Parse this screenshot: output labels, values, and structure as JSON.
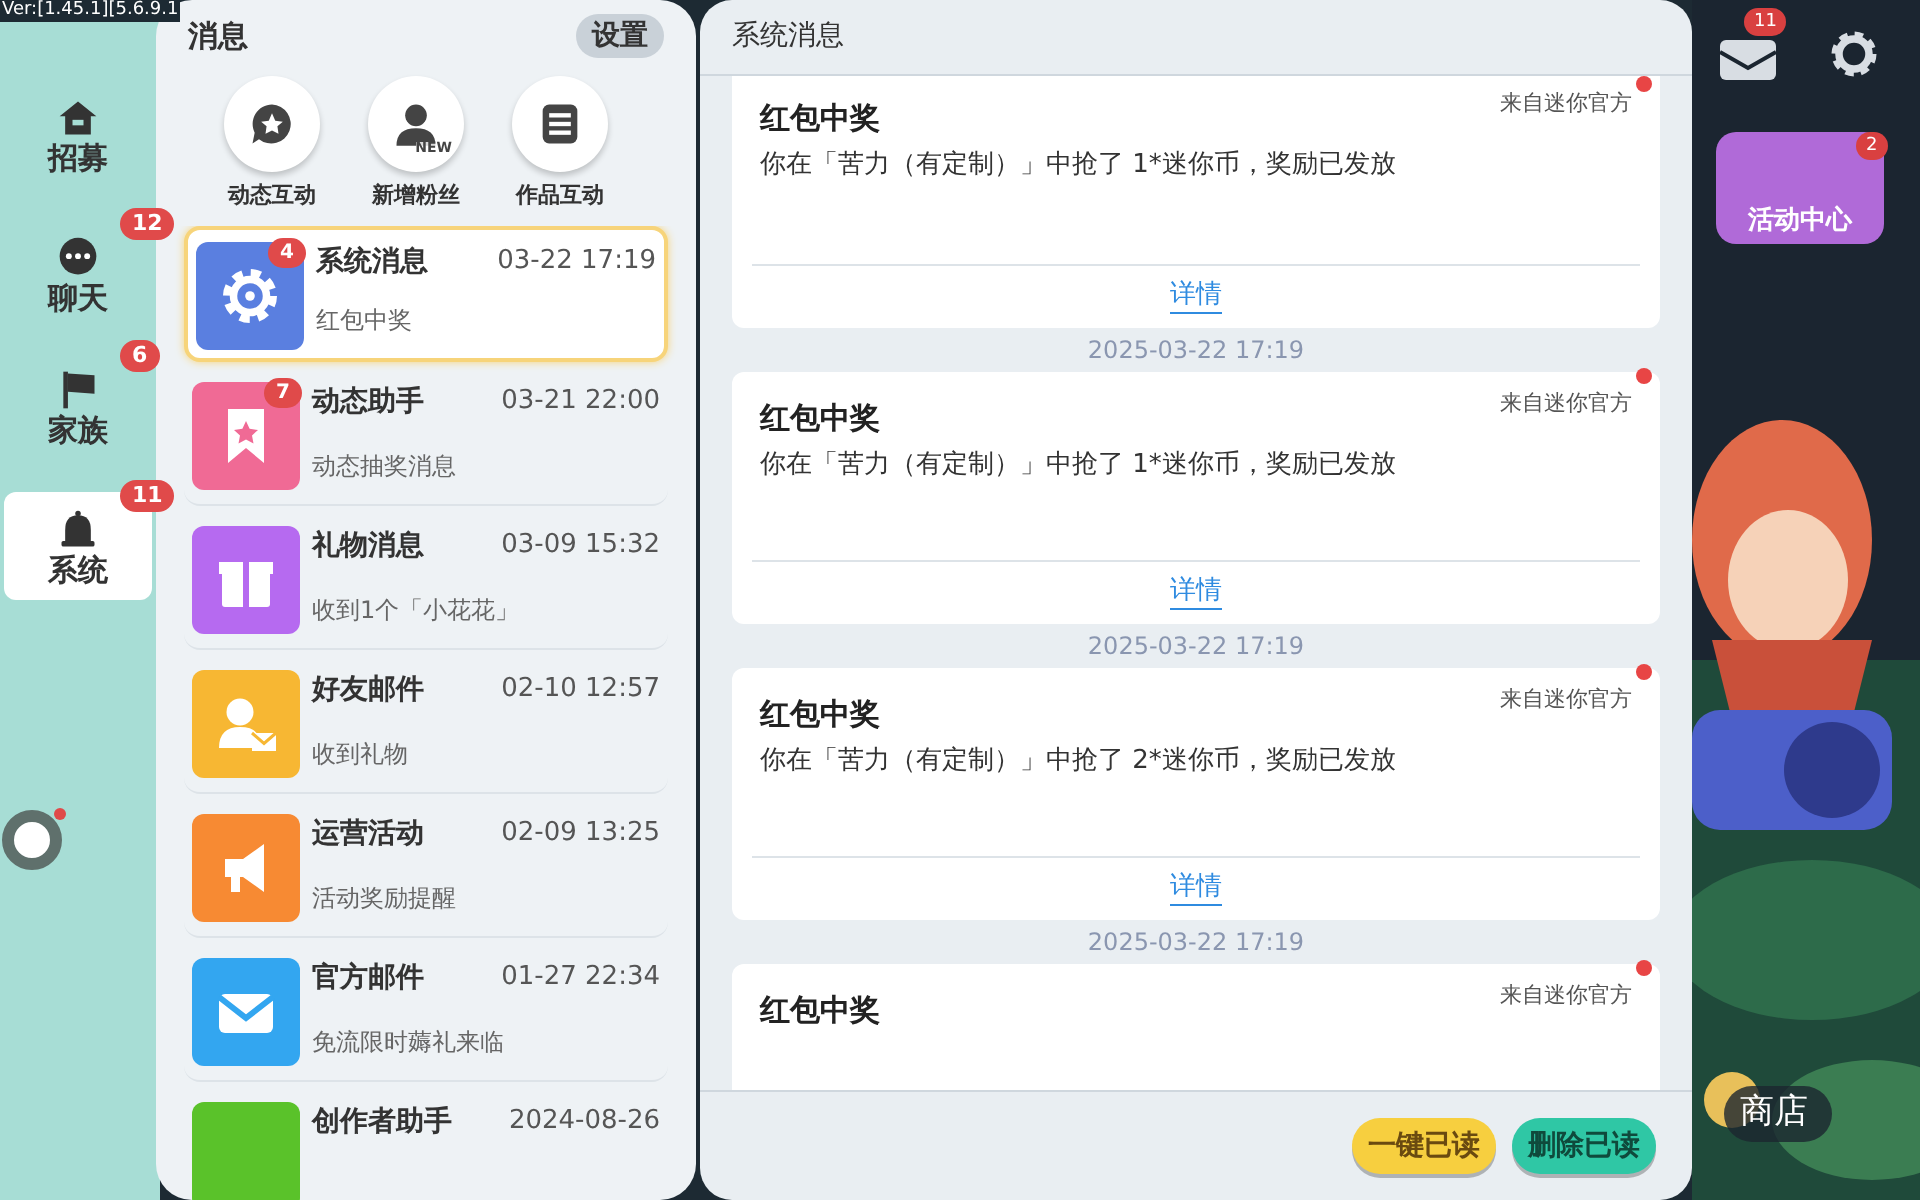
{
  "version_text": "Ver:[1.45.1][5.6.9.1",
  "nav": [
    {
      "label": "招募",
      "selected": false
    },
    {
      "label": "聊天",
      "badge": "12",
      "selected": false
    },
    {
      "label": "家族",
      "badge": "6",
      "selected": false
    },
    {
      "label": "系统",
      "badge": "11",
      "selected": true
    }
  ],
  "left_panel": {
    "title": "消息",
    "settings_button": "设置",
    "shortcuts": [
      {
        "label": "动态互动"
      },
      {
        "label": "新增粉丝",
        "tag": "NEW"
      },
      {
        "label": "作品互动"
      }
    ],
    "conversations": [
      {
        "title": "系统消息",
        "time": "03-22 17:19",
        "preview": "红包中奖",
        "badge": "4",
        "selected": true
      },
      {
        "title": "动态助手",
        "time": "03-21 22:00",
        "preview": "动态抽奖消息",
        "badge": "7",
        "selected": false
      },
      {
        "title": "礼物消息",
        "time": "03-09 15:32",
        "preview": "收到1个「小花花」",
        "selected": false
      },
      {
        "title": "好友邮件",
        "time": "02-10 12:57",
        "preview": "收到礼物",
        "selected": false
      },
      {
        "title": "运营活动",
        "time": "02-09 13:25",
        "preview": "活动奖励提醒",
        "selected": false
      },
      {
        "title": "官方邮件",
        "time": "01-27 22:34",
        "preview": "免流限时薅礼来临",
        "selected": false
      },
      {
        "title": "创作者助手",
        "time": "2024-08-26",
        "selected": false
      }
    ]
  },
  "detail": {
    "title": "系统消息",
    "cards": [
      {
        "title": "红包中奖",
        "source": "来自迷你官方",
        "body": "你在「苦力（有定制）」中抢了 1*迷你币，奖励已发放",
        "link": "详情",
        "unread": true
      },
      {
        "timestamp": "2025-03-22 17:19",
        "title": "红包中奖",
        "source": "来自迷你官方",
        "body": "你在「苦力（有定制）」中抢了 1*迷你币，奖励已发放",
        "link": "详情",
        "unread": true
      },
      {
        "timestamp": "2025-03-22 17:19",
        "title": "红包中奖",
        "source": "来自迷你官方",
        "body": "你在「苦力（有定制）」中抢了 2*迷你币，奖励已发放",
        "link": "详情",
        "unread": true
      },
      {
        "timestamp": "2025-03-22 17:19",
        "title": "红包中奖",
        "source": "来自迷你官方",
        "unread": true
      }
    ],
    "actions": [
      {
        "label": "一键已读",
        "kind": "yellow"
      },
      {
        "label": "删除已读",
        "kind": "teal"
      }
    ]
  },
  "hud": {
    "mail_badge": "11",
    "event_label": "活动中心",
    "event_badge": "2",
    "shop_label": "商店"
  }
}
